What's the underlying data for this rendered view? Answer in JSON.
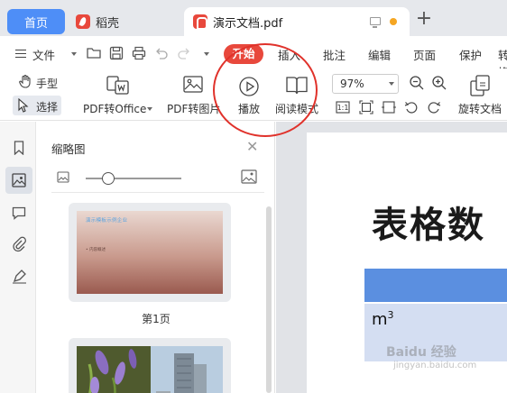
{
  "tabs": {
    "home": "首页",
    "store": "稻壳",
    "document": "演示文档.pdf",
    "new_tab": "+"
  },
  "menu": {
    "file": "文件",
    "items": [
      "开始",
      "插入",
      "批注",
      "编辑",
      "页面",
      "保护",
      "转换"
    ]
  },
  "ribbon": {
    "hand": "手型",
    "select": "选择",
    "pdf_to_office": "PDF转Office",
    "pdf_to_image": "PDF转图片",
    "play": "播放",
    "read_mode": "阅读模式",
    "zoom": "97%",
    "rotate_doc": "旋转文档"
  },
  "thumbnail_panel": {
    "title": "缩略图",
    "page1_label": "第1页",
    "page1_title": "演示模板示例企业",
    "page1_bullet": "• 内容概述"
  },
  "document": {
    "heading": "表格数",
    "unit_base": "m",
    "unit_exp": "3"
  },
  "watermark": {
    "main": "Baidu 经验",
    "sub": "jingyan.baidu.com"
  },
  "colors": {
    "accent_blue": "#4e8ef7",
    "brand_red": "#e8483c",
    "annotation_red": "#e0322b",
    "table_header": "#5b8fe0",
    "table_cell": "#d4def2"
  }
}
